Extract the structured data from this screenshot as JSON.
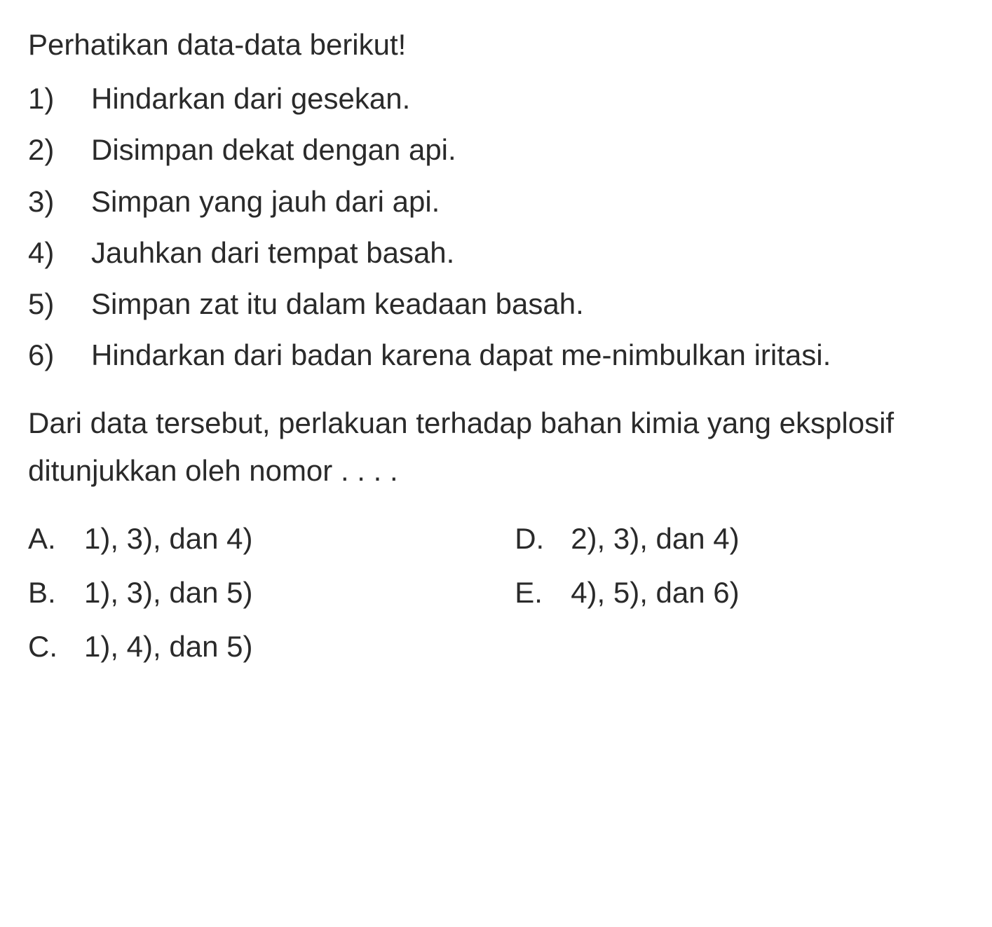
{
  "intro": "Perhatikan data-data berikut!",
  "list": [
    {
      "num": "1)",
      "text": "Hindarkan dari gesekan."
    },
    {
      "num": "2)",
      "text": "Disimpan dekat dengan api."
    },
    {
      "num": "3)",
      "text": "Simpan yang jauh dari api."
    },
    {
      "num": "4)",
      "text": "Jauhkan dari tempat basah."
    },
    {
      "num": "5)",
      "text": "Simpan zat itu dalam keadaan basah."
    },
    {
      "num": "6)",
      "text": "Hindarkan dari badan karena dapat me-nimbulkan iritasi."
    }
  ],
  "question": "Dari data tersebut, perlakuan terhadap bahan kimia yang eksplosif ditunjukkan oleh nomor . . . .",
  "options": {
    "left": [
      {
        "letter": "A.",
        "text": "1), 3), dan 4)"
      },
      {
        "letter": "B.",
        "text": "1), 3), dan 5)"
      },
      {
        "letter": "C.",
        "text": "1), 4), dan 5)"
      }
    ],
    "right": [
      {
        "letter": "D.",
        "text": "2), 3), dan 4)"
      },
      {
        "letter": "E.",
        "text": "4), 5), dan 6)"
      }
    ]
  }
}
